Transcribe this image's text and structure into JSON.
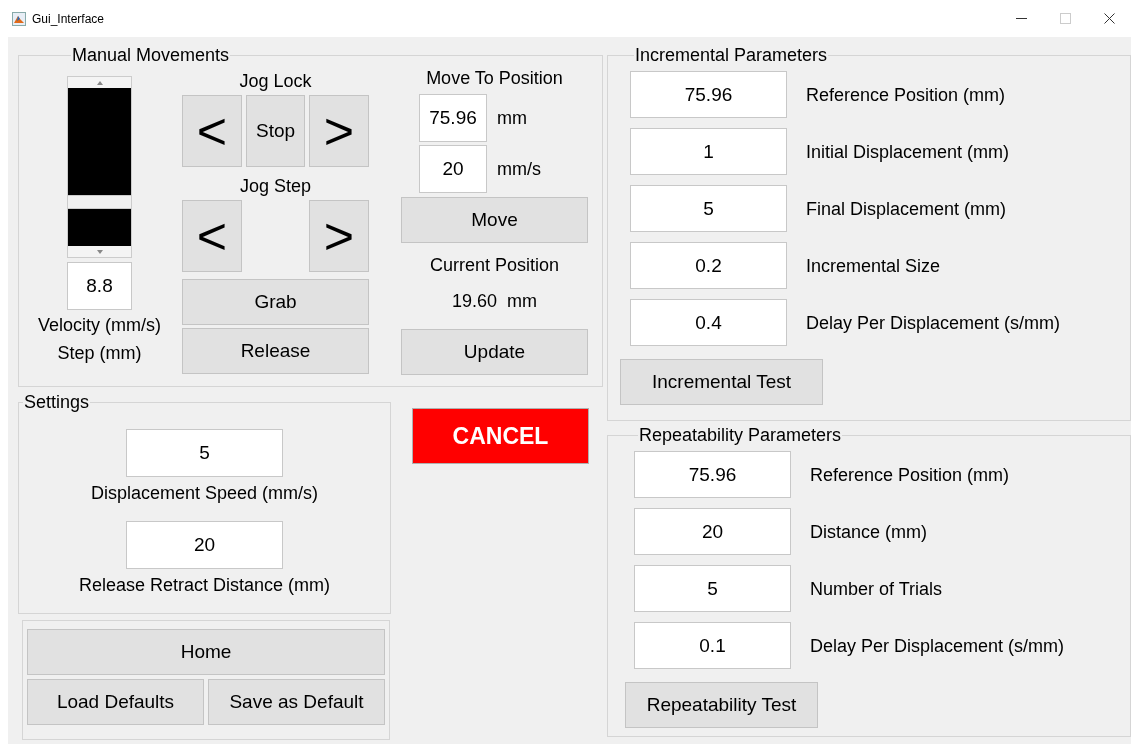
{
  "window": {
    "title": "Gui_Interface"
  },
  "manual_movements": {
    "title": "Manual Movements",
    "velocity_slider": {
      "level": 0.27
    },
    "velocity_value": "8.8",
    "velocity_label": "Velocity (mm/s)",
    "step_label": "Step (mm)",
    "jog_lock": {
      "title": "Jog Lock",
      "buttons": [
        "<",
        "Stop",
        ">"
      ]
    },
    "jog_step": {
      "title": "Jog Step",
      "buttons": [
        "<",
        ">"
      ]
    },
    "grab": "Grab",
    "release": "Release",
    "move_to_position": {
      "title": "Move To Position",
      "position_value": "75.96",
      "position_unit": "mm",
      "speed_value": "20",
      "speed_unit": "mm/s",
      "move": "Move"
    },
    "current_position": {
      "title": "Current Position",
      "value": "19.60  mm"
    },
    "update": "Update"
  },
  "settings": {
    "title": "Settings",
    "fields": [
      {
        "value": "5",
        "label": "Displacement Speed (mm/s)"
      },
      {
        "value": "20",
        "label": "Release Retract Distance (mm)"
      }
    ]
  },
  "cancel": "CANCEL",
  "defaults": {
    "home": "Home",
    "load": "Load Defaults",
    "save": "Save as Default"
  },
  "incremental_parameters": {
    "title": "Incremental Parameters",
    "fields": [
      {
        "value": "75.96",
        "label": "Reference Position (mm)"
      },
      {
        "value": "1",
        "label": "Initial Displacement (mm)"
      },
      {
        "value": "5",
        "label": "Final Displacement (mm)"
      },
      {
        "value": "0.2",
        "label": "Incremental Size"
      },
      {
        "value": "0.4",
        "label": "Delay Per Displacement (s/mm)"
      }
    ],
    "button": "Incremental Test"
  },
  "repeatability_parameters": {
    "title": "Repeatability Parameters",
    "fields": [
      {
        "value": "75.96",
        "label": "Reference Position (mm)"
      },
      {
        "value": "20",
        "label": "Distance (mm)"
      },
      {
        "value": "5",
        "label": "Number of Trials"
      },
      {
        "value": "0.1",
        "label": "Delay Per Displacement (s/mm)"
      }
    ],
    "button": "Repeatability Test"
  }
}
